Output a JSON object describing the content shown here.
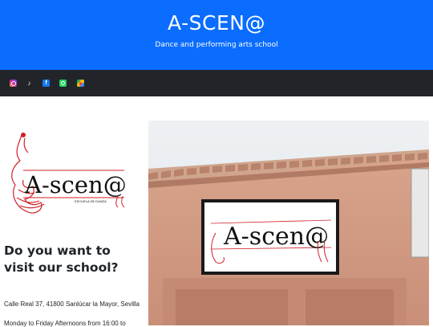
{
  "header": {
    "title": "A-SCEN@",
    "subtitle": "Dance and performing arts school"
  },
  "social": {
    "items": [
      {
        "name": "instagram",
        "icon": "instagram-icon"
      },
      {
        "name": "tiktok",
        "icon": "tiktok-icon"
      },
      {
        "name": "facebook",
        "icon": "facebook-icon"
      },
      {
        "name": "whatsapp",
        "icon": "whatsapp-icon"
      },
      {
        "name": "google-maps",
        "icon": "maps-icon"
      }
    ]
  },
  "logo": {
    "text": "A-scen@",
    "tagline": "ESCUELA DE DANZA"
  },
  "visit": {
    "heading": "Do you want to visit our school?",
    "address": "Calle Real 37, 41800 Sanlúcar la Mayor, Sevilla",
    "hours": "Monday to Friday Afternoons from 16:00 to"
  },
  "photo": {
    "sign_text": "A-scen@"
  },
  "colors": {
    "header_bg": "#0b6dff",
    "social_bg": "#212529",
    "logo_red": "#d0202a"
  }
}
